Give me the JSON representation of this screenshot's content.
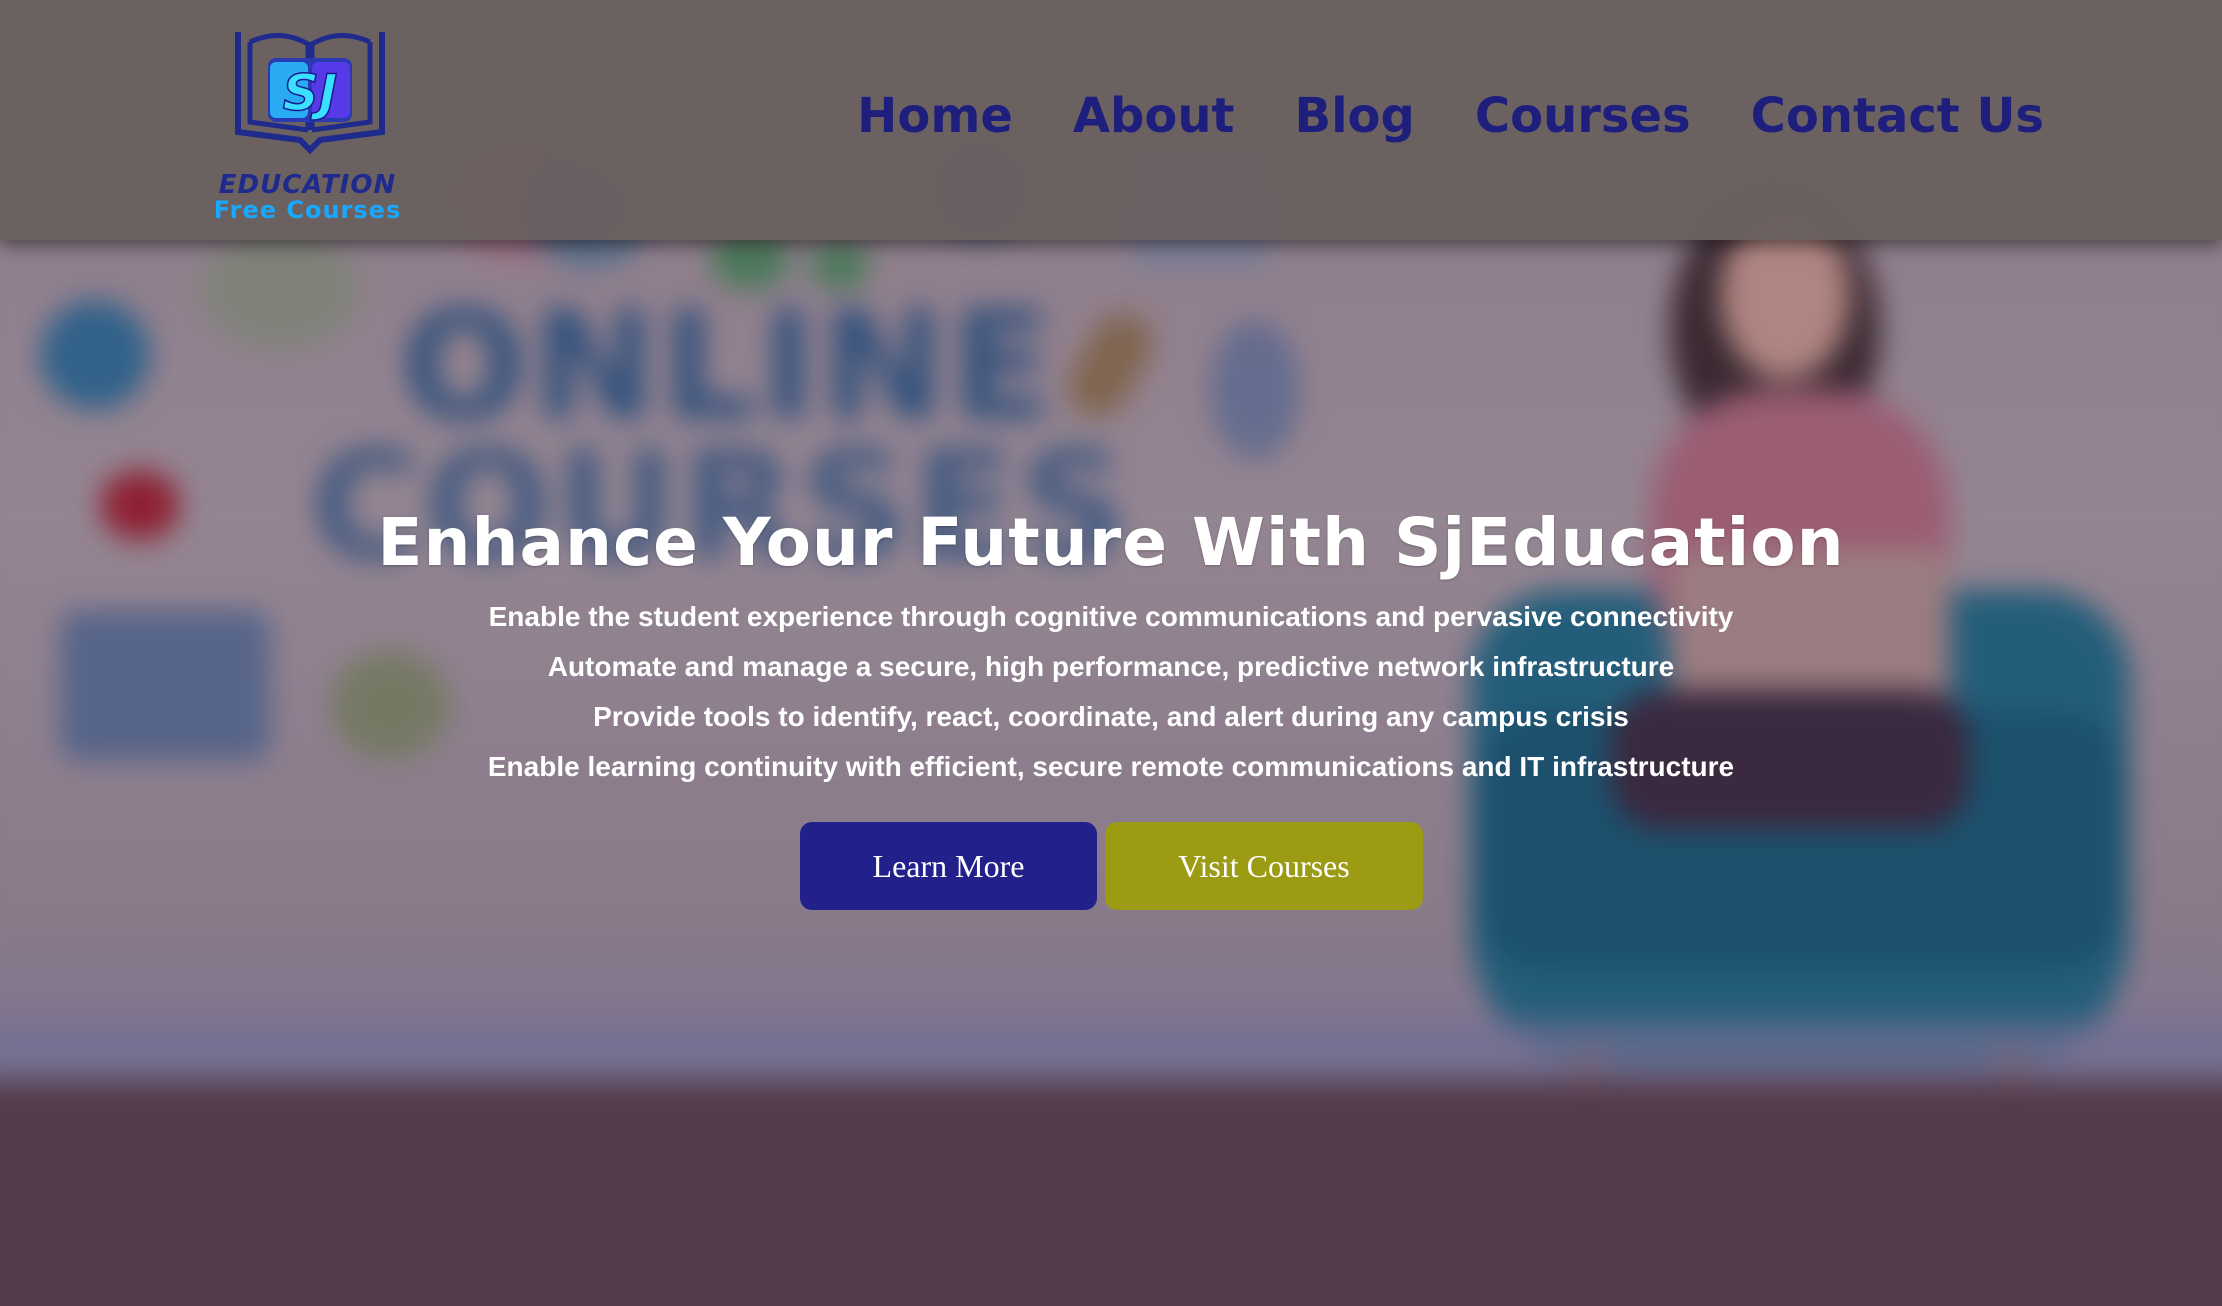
{
  "brand": {
    "monogram": "SJ",
    "line1": "EDUCATION",
    "line2": "Free Courses",
    "colors": {
      "navy": "#1e2a8c",
      "cyan": "#18a8ff"
    }
  },
  "nav": {
    "items": [
      {
        "label": "Home"
      },
      {
        "label": "About"
      },
      {
        "label": "Blog"
      },
      {
        "label": "Courses"
      },
      {
        "label": "Contact Us"
      }
    ],
    "color": "#1e1f7c"
  },
  "background": {
    "wall_text_1": "ONLINE",
    "wall_text_2": "COURSES"
  },
  "hero": {
    "title": "Enhance Your Future With SjEducation",
    "lines": [
      "Enable the student experience through cognitive communications and pervasive connectivity",
      "Automate and manage a secure, high performance, predictive network infrastructure",
      "Provide tools to identify, react, coordinate, and alert during any campus crisis",
      "Enable learning continuity with efficient, secure remote communications and IT infrastructure"
    ]
  },
  "buttons": {
    "primary": {
      "label": "Learn More",
      "color": "#22218b"
    },
    "secondary": {
      "label": "Visit Courses",
      "color": "#9c9b14"
    }
  }
}
